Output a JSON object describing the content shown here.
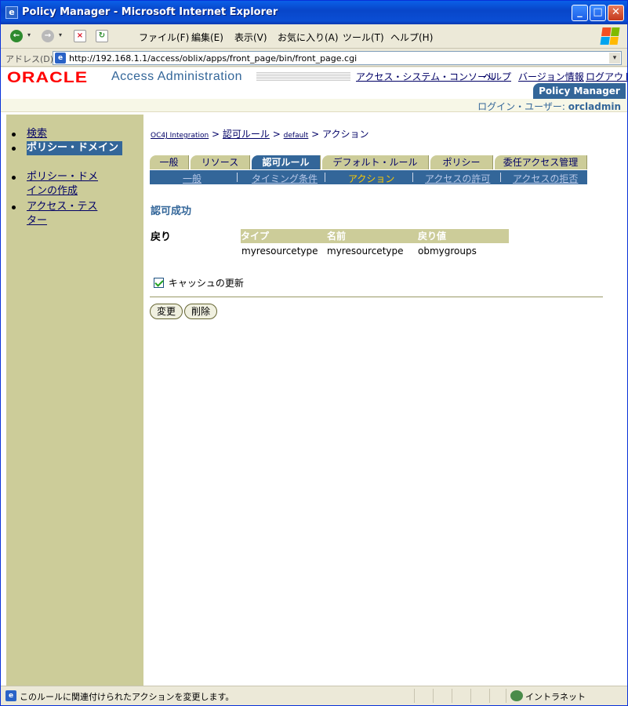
{
  "window": {
    "title": "Policy Manager - Microsoft Internet Explorer",
    "app_icon": "e",
    "min_glyph": "_",
    "max_glyph": "□",
    "close_glyph": "✕"
  },
  "menubar": {
    "items": [
      "ファイル(F)",
      "編集(E)",
      "表示(V)",
      "お気に入り(A)",
      "ツール(T)",
      "ヘルプ(H)"
    ]
  },
  "toolbar_icons": {
    "back": "←",
    "forward": "→",
    "dropdown": "▾",
    "stop": "×",
    "refresh": "↻"
  },
  "addressbar": {
    "label": "アドレス(D)",
    "url": "http://192.168.1.1/access/oblix/apps/front_page/bin/front_page.cgi",
    "icon": "e",
    "drop_glyph": "▾"
  },
  "header": {
    "logo": "ORACLE",
    "app_title": "Access Administration",
    "links": [
      "アクセス・システム・コンソール",
      "ヘルプ",
      "バージョン情報",
      "ログアウト"
    ],
    "active_app_tab": "Policy Manager",
    "login_label": "ログイン・ユーザー:",
    "login_user": "orcladmin"
  },
  "sidebar": {
    "items": [
      {
        "label": "検索"
      },
      {
        "label": "ポリシー・ドメイン"
      },
      {
        "label": "ポリシー・ドメインの作成"
      },
      {
        "label": "アクセス・テスター"
      }
    ]
  },
  "breadcrumb": {
    "items": [
      "OC4J Integration",
      "認可ルール",
      "default",
      "アクション"
    ],
    "separator": ">"
  },
  "tabs": [
    "一般",
    "リソース",
    "認可ルール",
    "デフォルト・ルール",
    "ポリシー",
    "委任アクセス管理"
  ],
  "subtabs": [
    "一般",
    "タイミング条件",
    "アクション",
    "アクセスの許可",
    "アクセスの拒否"
  ],
  "section": {
    "title": "認可成功",
    "return_label": "戻り",
    "columns": [
      "タイプ",
      "名前",
      "戻り値"
    ],
    "rows": [
      [
        "myresourcetype",
        "myresourcetype",
        "obmygroups"
      ]
    ],
    "cache_label": "キャッシュの更新"
  },
  "buttons": {
    "modify": "変更",
    "delete": "削除"
  },
  "statusbar": {
    "icon": "e",
    "message": "このルールに関連付けられたアクションを変更します。",
    "zone": "イントラネット"
  },
  "colors": {
    "oracle_red": "#ff0000",
    "accent_blue": "#336699",
    "tan": "#cccc99",
    "active_subtab": "#ffcc00"
  }
}
